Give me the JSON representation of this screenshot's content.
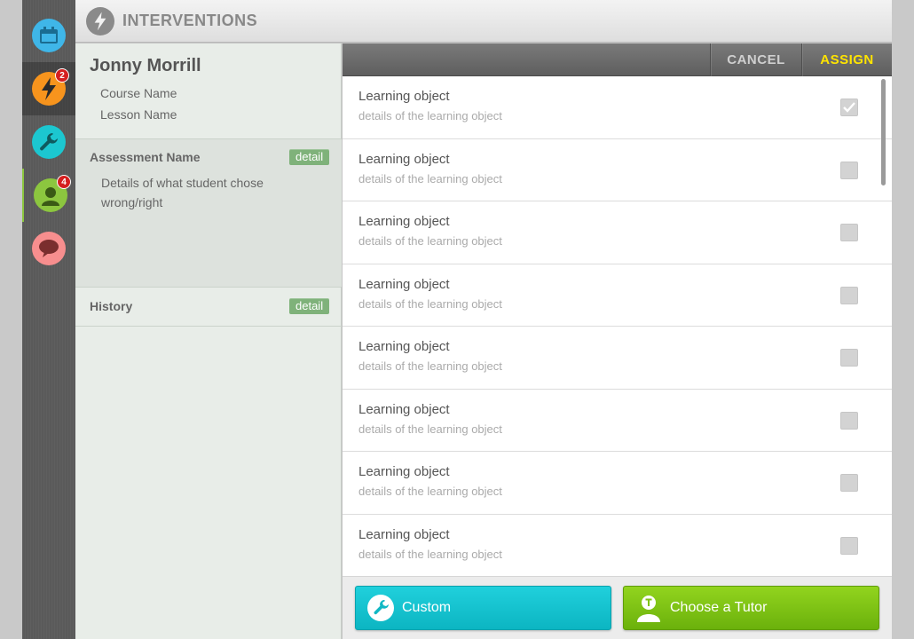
{
  "header": {
    "title": "INTERVENTIONS"
  },
  "nav": {
    "items": [
      {
        "name": "calendar",
        "color": "#3fb6e8",
        "badge": null
      },
      {
        "name": "interventions",
        "color": "#f7941d",
        "badge": "2"
      },
      {
        "name": "tools",
        "color": "#1cc7d0",
        "badge": null
      },
      {
        "name": "students",
        "color": "#8cc63f",
        "badge": "4"
      },
      {
        "name": "messages",
        "color": "#f78e8e",
        "badge": null
      }
    ]
  },
  "student": {
    "name": "Jonny Morrill",
    "course": "Course Name",
    "lesson": "Lesson Name"
  },
  "assessment": {
    "title": "Assessment Name",
    "detail_label": "detail",
    "details": "Details of what student chose wrong/right"
  },
  "history": {
    "title": "History",
    "detail_label": "detail"
  },
  "toolbar": {
    "cancel_label": "CANCEL",
    "assign_label": "ASSIGN"
  },
  "learning_objects": [
    {
      "title": "Learning object",
      "subtitle": "details of the learning object",
      "checked": true
    },
    {
      "title": "Learning object",
      "subtitle": "details of the learning object",
      "checked": false
    },
    {
      "title": "Learning object",
      "subtitle": "details of the learning object",
      "checked": false
    },
    {
      "title": "Learning object",
      "subtitle": "details of the learning object",
      "checked": false
    },
    {
      "title": "Learning object",
      "subtitle": "details of the learning object",
      "checked": false
    },
    {
      "title": "Learning object",
      "subtitle": "details of the learning object",
      "checked": false
    },
    {
      "title": "Learning object",
      "subtitle": "details of the learning object",
      "checked": false
    },
    {
      "title": "Learning object",
      "subtitle": "details of the learning object",
      "checked": false
    }
  ],
  "actions": {
    "custom_label": "Custom",
    "tutor_label": "Choose a Tutor"
  }
}
